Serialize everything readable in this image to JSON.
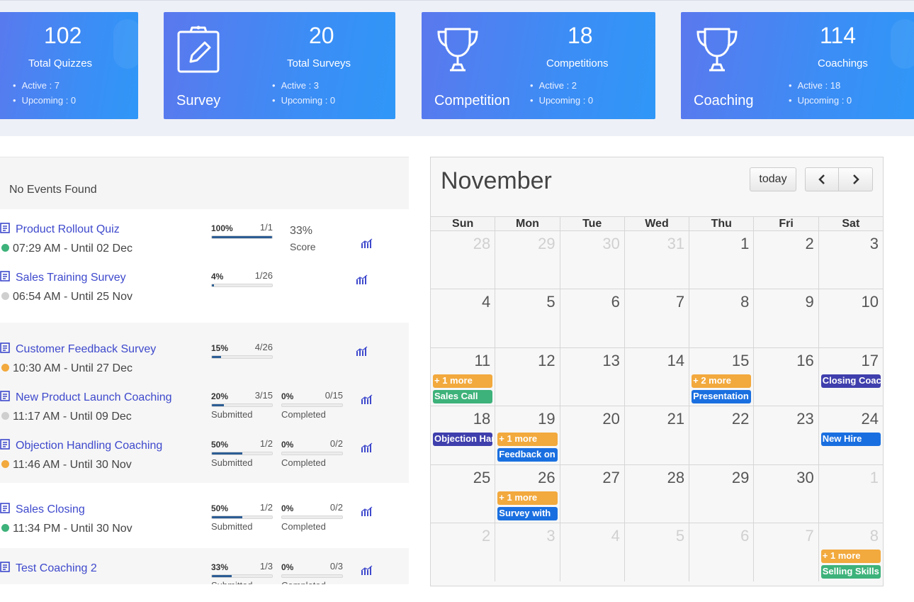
{
  "stats": [
    {
      "value": "102",
      "label": "Total Quizzes",
      "name": "",
      "active": "Active : 7",
      "upcoming": "Upcoming : 0",
      "icon": "quiz-icon"
    },
    {
      "value": "20",
      "label": "Total Surveys",
      "name": "Survey",
      "active": "Active : 3",
      "upcoming": "Upcoming : 0",
      "icon": "clipboard-icon"
    },
    {
      "value": "18",
      "label": "Competitions",
      "name": "Competition",
      "active": "Active : 2",
      "upcoming": "Upcoming : 0",
      "icon": "trophy-icon"
    },
    {
      "value": "114",
      "label": "Coachings",
      "name": "Coaching",
      "active": "Active : 18",
      "upcoming": "Upcoming : 0",
      "icon": "trophy-icon"
    }
  ],
  "events": {
    "header": "No Events Found",
    "items": [
      {
        "title": "Product Rollout Quiz",
        "time": "07:29 AM - Until 02 Dec",
        "status_color": "#3db27a",
        "progress": {
          "pct": "100%",
          "frac": "1/1",
          "value": 1.0,
          "label": ""
        },
        "score": "33%",
        "score_label": "Score"
      },
      {
        "title": "Sales Training Survey",
        "time": "06:54 AM - Until 25 Nov",
        "status_color": "#cfcfcf",
        "progress": {
          "pct": "4%",
          "frac": "1/26",
          "value": 0.04,
          "label": ""
        }
      },
      {
        "title": "Customer Feedback Survey",
        "time": "10:30 AM - Until 27 Dec",
        "status_color": "#f2a93d",
        "progress": {
          "pct": "15%",
          "frac": "4/26",
          "value": 0.15,
          "label": ""
        }
      },
      {
        "title": "New Product Launch Coaching",
        "time": "11:17 AM - Until 09 Dec",
        "status_color": "#cfcfcf",
        "progress": {
          "pct": "20%",
          "frac": "3/15",
          "value": 0.2,
          "label": "Submitted"
        },
        "progress2": {
          "pct": "0%",
          "frac": "0/15",
          "value": 0,
          "label": "Completed"
        }
      },
      {
        "title": "Objection Handling Coaching",
        "time": "11:46 AM - Until 30 Nov",
        "status_color": "#f2a93d",
        "progress": {
          "pct": "50%",
          "frac": "1/2",
          "value": 0.5,
          "label": "Submitted"
        },
        "progress2": {
          "pct": "0%",
          "frac": "0/2",
          "value": 0,
          "label": "Completed"
        }
      },
      {
        "title": "Sales Closing",
        "time": "11:34 PM - Until 30 Nov",
        "status_color": "#3db27a",
        "progress": {
          "pct": "50%",
          "frac": "1/2",
          "value": 0.5,
          "label": "Submitted"
        },
        "progress2": {
          "pct": "0%",
          "frac": "0/2",
          "value": 0,
          "label": "Completed"
        }
      },
      {
        "title": "Test Coaching 2",
        "time": "",
        "status_color": "#f2a93d",
        "progress": {
          "pct": "33%",
          "frac": "1/3",
          "value": 0.33,
          "label": "Submitted"
        },
        "progress2": {
          "pct": "0%",
          "frac": "0/3",
          "value": 0,
          "label": "Completed"
        }
      }
    ]
  },
  "calendar": {
    "month": "November",
    "today_label": "today",
    "prev_label": "‹",
    "next_label": "›",
    "days_of_week": [
      "Sun",
      "Mon",
      "Tue",
      "Wed",
      "Thu",
      "Fri",
      "Sat"
    ],
    "weeks": [
      [
        {
          "d": "28",
          "other": true
        },
        {
          "d": "29",
          "other": true
        },
        {
          "d": "30",
          "other": true
        },
        {
          "d": "31",
          "other": true
        },
        {
          "d": "1"
        },
        {
          "d": "2"
        },
        {
          "d": "3"
        }
      ],
      [
        {
          "d": "4"
        },
        {
          "d": "5"
        },
        {
          "d": "6"
        },
        {
          "d": "7"
        },
        {
          "d": "8"
        },
        {
          "d": "9"
        },
        {
          "d": "10"
        }
      ],
      [
        {
          "d": "11",
          "events": [
            {
              "t": "+ 1 more",
              "k": "more"
            },
            {
              "t": "Sales Call",
              "k": "green"
            }
          ]
        },
        {
          "d": "12"
        },
        {
          "d": "13"
        },
        {
          "d": "14"
        },
        {
          "d": "15",
          "events": [
            {
              "t": "+ 2 more",
              "k": "more"
            },
            {
              "t": "Presentation",
              "k": "blue"
            }
          ]
        },
        {
          "d": "16"
        },
        {
          "d": "17",
          "events": [
            {
              "t": "Closing Coaching",
              "k": "indigo",
              "top": true
            }
          ]
        }
      ],
      [
        {
          "d": "18",
          "events": [
            {
              "t": "Objection Handling",
              "k": "indigo",
              "top": true
            }
          ]
        },
        {
          "d": "19",
          "events": [
            {
              "t": "+ 1 more",
              "k": "more"
            },
            {
              "t": "Feedback on",
              "k": "blue"
            }
          ]
        },
        {
          "d": "20"
        },
        {
          "d": "21"
        },
        {
          "d": "22"
        },
        {
          "d": "23"
        },
        {
          "d": "24",
          "events": [
            {
              "t": "New Hire",
              "k": "blue",
              "top": true
            }
          ]
        }
      ],
      [
        {
          "d": "25"
        },
        {
          "d": "26",
          "events": [
            {
              "t": "+ 1 more",
              "k": "more"
            },
            {
              "t": "Survey with",
              "k": "blue"
            }
          ]
        },
        {
          "d": "27"
        },
        {
          "d": "28"
        },
        {
          "d": "29"
        },
        {
          "d": "30"
        },
        {
          "d": "1",
          "other": true
        }
      ],
      [
        {
          "d": "2",
          "other": true
        },
        {
          "d": "3",
          "other": true
        },
        {
          "d": "4",
          "other": true
        },
        {
          "d": "5",
          "other": true
        },
        {
          "d": "6",
          "other": true
        },
        {
          "d": "7",
          "other": true
        },
        {
          "d": "8",
          "other": true,
          "events": [
            {
              "t": "+ 1 more",
              "k": "more"
            },
            {
              "t": "Selling Skills",
              "k": "green"
            }
          ]
        }
      ]
    ]
  }
}
